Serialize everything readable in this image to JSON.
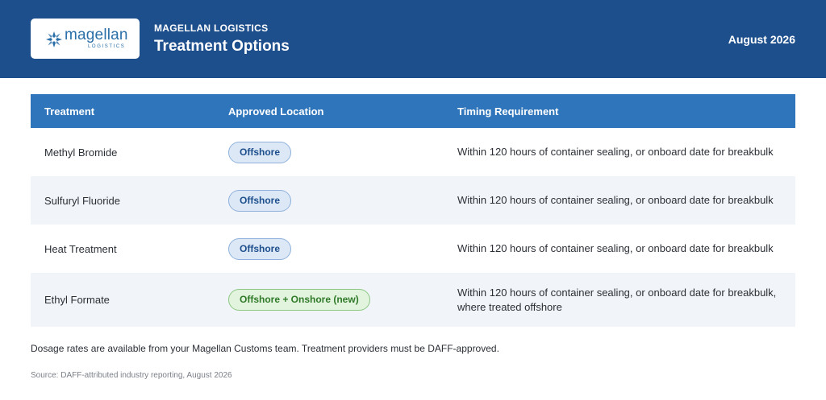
{
  "header": {
    "logo_word": "magellan",
    "logo_sub": "LOGISTICS",
    "company": "MAGELLAN LOGISTICS",
    "title": "Treatment Options",
    "date": "August 2026"
  },
  "table": {
    "columns": [
      "Treatment",
      "Approved Location",
      "Timing Requirement"
    ],
    "rows": [
      {
        "treatment": "Methyl Bromide",
        "location": "Offshore",
        "location_type": "offshore",
        "timing": "Within 120 hours of container sealing, or onboard date for breakbulk"
      },
      {
        "treatment": "Sulfuryl Fluoride",
        "location": "Offshore",
        "location_type": "offshore",
        "timing": "Within 120 hours of container sealing, or onboard date for breakbulk"
      },
      {
        "treatment": "Heat Treatment",
        "location": "Offshore",
        "location_type": "offshore",
        "timing": "Within 120 hours of container sealing, or onboard date for breakbulk"
      },
      {
        "treatment": "Ethyl Formate",
        "location": "Offshore + Onshore (new)",
        "location_type": "both",
        "timing": "Within 120 hours of container sealing, or onboard date for breakbulk, where treated offshore"
      }
    ]
  },
  "footer": {
    "note": "Dosage rates are available from your Magellan Customs team. Treatment providers must be DAFF-approved.",
    "source": "Source: DAFF-attributed industry reporting, August 2026"
  },
  "colors": {
    "header_bg": "#1e4f8d",
    "table_header_bg": "#2f75bb",
    "offshore_pill": "#dce8f6",
    "both_pill": "#e2f3de"
  },
  "icons": {
    "logo": "star-burst-logo-icon"
  }
}
